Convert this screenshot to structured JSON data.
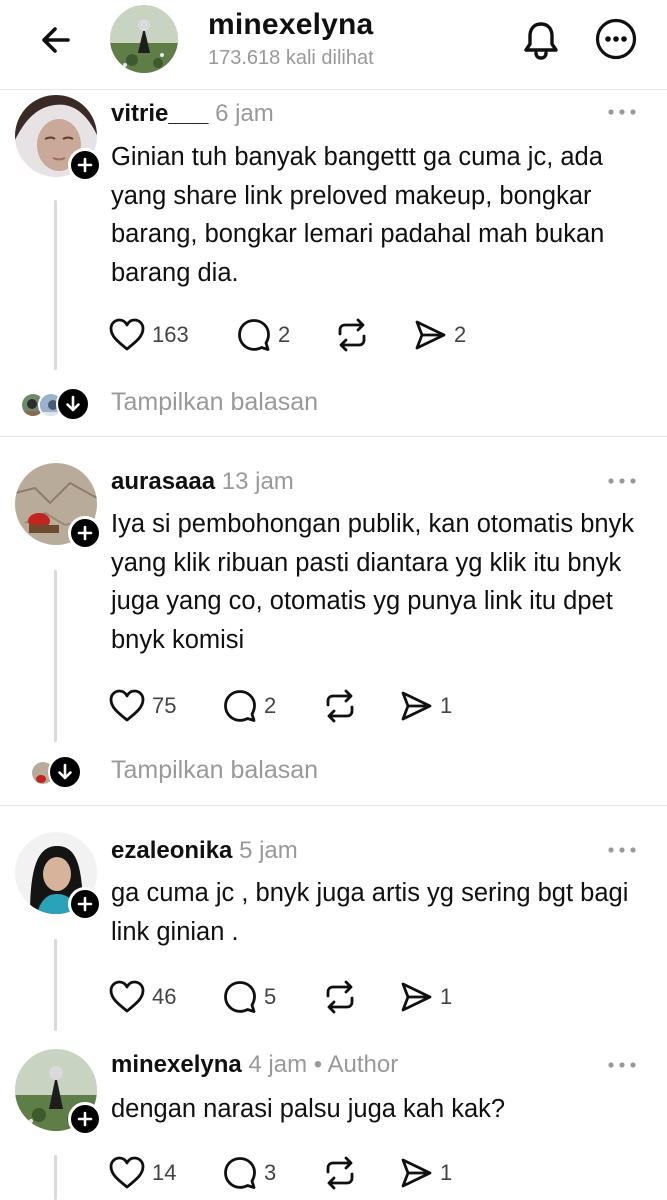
{
  "header": {
    "title": "minexelyna",
    "subtitle": "173.618 kali dilihat",
    "back_icon": "arrow-left-icon",
    "bell_icon": "bell-icon",
    "more_icon": "more-circle-icon"
  },
  "posts": [
    {
      "username": "vitrie___",
      "time": "6 jam",
      "author_tag": "",
      "text": "Ginian tuh banyak bangettt ga cuma jc, ada yang share link preloved makeup, bongkar barang, bongkar lemari padahal mah bukan barang  dia.",
      "likes": "163",
      "comments": "2",
      "shares": "2",
      "show_replies": "Tampilkan balasan"
    },
    {
      "username": "aurasaaa",
      "time": "13 jam",
      "author_tag": "",
      "text": "Iya si pembohongan publik, kan otomatis bnyk yang klik ribuan pasti diantara yg klik itu bnyk juga yang co, otomatis yg punya link itu dpet bnyk komisi",
      "likes": "75",
      "comments": "2",
      "shares": "1",
      "show_replies": "Tampilkan balasan"
    },
    {
      "username": "ezaleonika",
      "time": "5 jam",
      "author_tag": "",
      "text": "ga cuma jc , bnyk juga artis yg sering bgt bagi link ginian .",
      "likes": "46",
      "comments": "5",
      "shares": "1"
    },
    {
      "username": "minexelyna",
      "time": "4 jam",
      "author_tag": "• Author",
      "text": "dengan narasi palsu juga kah kak?",
      "likes": "14",
      "comments": "3",
      "shares": "1"
    }
  ],
  "icons": {
    "like": "heart-icon",
    "comment": "comment-icon",
    "repost": "repost-icon",
    "share": "send-icon"
  }
}
